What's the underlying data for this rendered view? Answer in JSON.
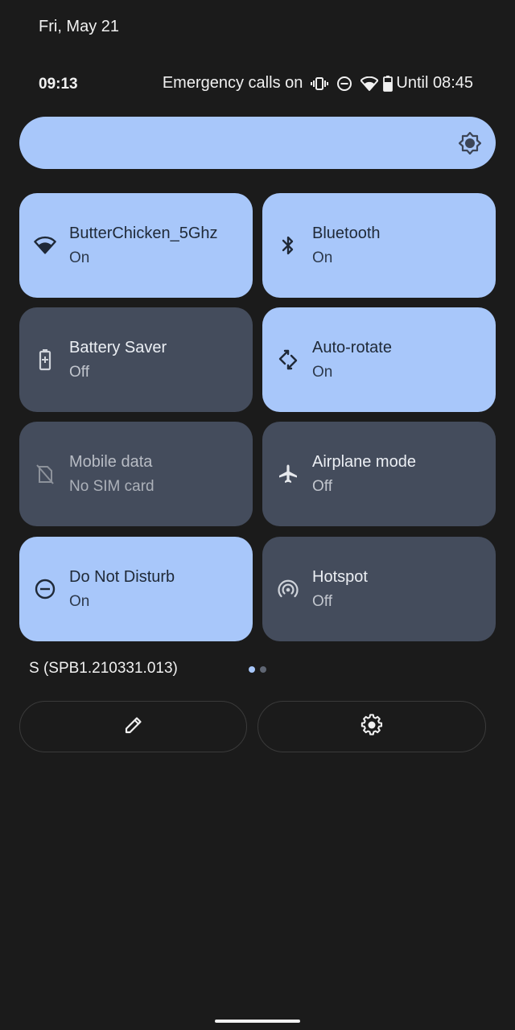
{
  "header": {
    "date": "Fri, May 21",
    "time": "09:13",
    "emergency_text": "Emergency calls on",
    "status_icons": [
      "vibrate-icon",
      "do-not-disturb-icon",
      "wifi-icon",
      "battery-icon"
    ],
    "alarm_text": "Until 08:45"
  },
  "brightness": {
    "icon": "brightness-icon",
    "level_percent": 100
  },
  "tiles": [
    {
      "label": "ButterChicken_5Ghz",
      "status": "On",
      "icon": "wifi-icon",
      "state": "on"
    },
    {
      "label": "Bluetooth",
      "status": "On",
      "icon": "bluetooth-icon",
      "state": "on"
    },
    {
      "label": "Battery Saver",
      "status": "Off",
      "icon": "battery-saver-icon",
      "state": "off"
    },
    {
      "label": "Auto-rotate",
      "status": "On",
      "icon": "auto-rotate-icon",
      "state": "on"
    },
    {
      "label": "Mobile data",
      "status": "No SIM card",
      "icon": "no-sim-icon",
      "state": "unavailable"
    },
    {
      "label": "Airplane mode",
      "status": "Off",
      "icon": "airplane-icon",
      "state": "off"
    },
    {
      "label": "Do Not Disturb",
      "status": "On",
      "icon": "do-not-disturb-icon",
      "state": "on"
    },
    {
      "label": "Hotspot",
      "status": "Off",
      "icon": "hotspot-icon",
      "state": "off"
    }
  ],
  "footer": {
    "build": "S (SPB1.210331.013)",
    "page_indicator": {
      "current": 1,
      "total": 2
    },
    "edit_button": "edit-icon",
    "settings_button": "settings-icon"
  },
  "colors": {
    "background": "#1b1b1b",
    "tile_on": "#a8c7fa",
    "tile_off": "#444c5c",
    "dot_active": "#a8c7fa",
    "dot_inactive": "#5f6673"
  }
}
